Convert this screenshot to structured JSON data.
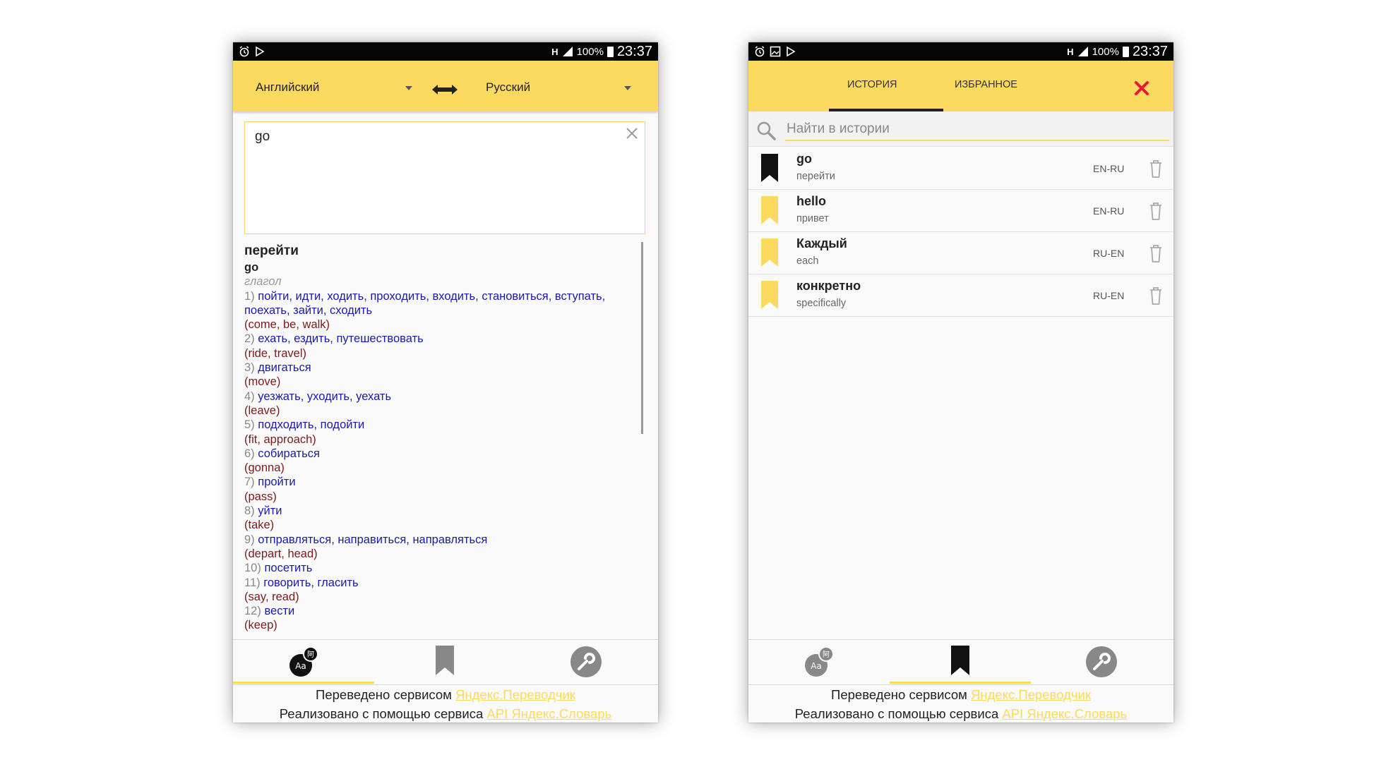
{
  "status_bar": {
    "battery": "100%",
    "time": "23:37",
    "network": "H"
  },
  "left_screen": {
    "source_language": "Английский",
    "target_language": "Русский",
    "input_text": "go",
    "result": {
      "title": "перейти",
      "word": "go",
      "part_of_speech": "глагол",
      "meanings": [
        {
          "num": "1)",
          "translations": "пойти, идти, ходить, проходить, входить, становиться, вступать,",
          "translations_cont": "поехать, зайти, сходить",
          "examples": "(come, be, walk)"
        },
        {
          "num": "2)",
          "translations": "ехать, ездить, путешествовать",
          "examples": "(ride, travel)"
        },
        {
          "num": "3)",
          "translations": "двигаться",
          "examples": "(move)"
        },
        {
          "num": "4)",
          "translations": "уезжать, уходить, уехать",
          "examples": "(leave)"
        },
        {
          "num": "5)",
          "translations": "подходить, подойти",
          "examples": "(fit, approach)"
        },
        {
          "num": "6)",
          "translations": "собираться",
          "examples": "(gonna)"
        },
        {
          "num": "7)",
          "translations": "пройти",
          "examples": "(pass)"
        },
        {
          "num": "8)",
          "translations": "уйти",
          "examples": "(take)"
        },
        {
          "num": "9)",
          "translations": "отправляться, направиться, направляться",
          "examples": "(depart, head)"
        },
        {
          "num": "10)",
          "translations": "посетить",
          "examples": ""
        },
        {
          "num": "11)",
          "translations": "говорить, гласить",
          "examples": "(say, read)"
        },
        {
          "num": "12)",
          "translations": "вести",
          "examples": "(keep)"
        }
      ]
    }
  },
  "right_screen": {
    "tabs": [
      "ИСТОРИЯ",
      "ИЗБРАННОЕ"
    ],
    "active_tab": "ИСТОРИЯ",
    "search_placeholder": "Найти в истории",
    "history": [
      {
        "word": "go",
        "translation": "перейти",
        "lang": "EN-RU",
        "bookmarked": true
      },
      {
        "word": "hello",
        "translation": "привет",
        "lang": "EN-RU",
        "bookmarked": false
      },
      {
        "word": "Каждый",
        "translation": "each",
        "lang": "RU-EN",
        "bookmarked": false
      },
      {
        "word": "конкретно",
        "translation": "specifically",
        "lang": "RU-EN",
        "bookmarked": false
      }
    ]
  },
  "footer": {
    "line1_prefix": "Переведено сервисом ",
    "line1_link": "Яндекс.Переводчик",
    "line2_prefix": "Реализовано с помощью сервиса ",
    "line2_link": "API Яндекс.Словарь"
  },
  "nav_icons": [
    "translate-icon",
    "bookmark-icon",
    "settings-wrench-icon"
  ],
  "colors": {
    "accent_yellow": "#fcd95f",
    "translation_blue": "#1a1aa8",
    "example_red": "#7a1a1a",
    "close_red": "#e8173c"
  }
}
